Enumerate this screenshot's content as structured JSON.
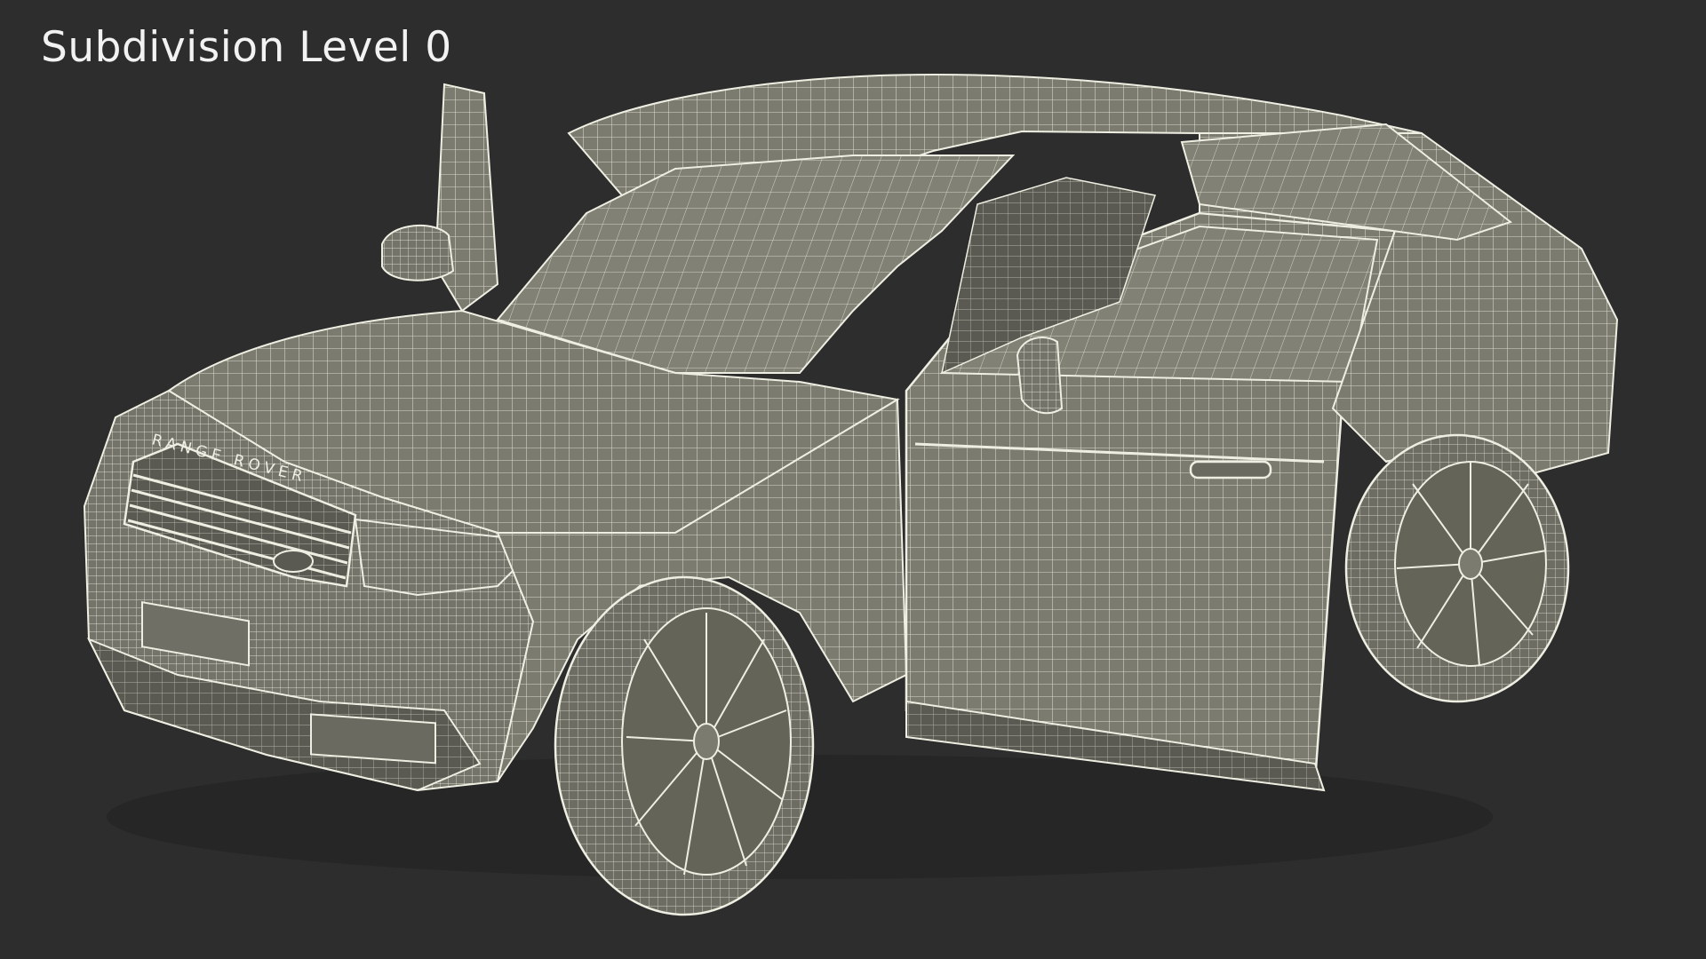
{
  "caption": "Subdivision Level 0",
  "emblem": "RANGE ROVER",
  "colors": {
    "background": "#2d2d2d",
    "surface": "#7d7d70",
    "surface_dark": "#5f5f56",
    "wire": "#efeee2",
    "caption": "#f2f2f2"
  }
}
